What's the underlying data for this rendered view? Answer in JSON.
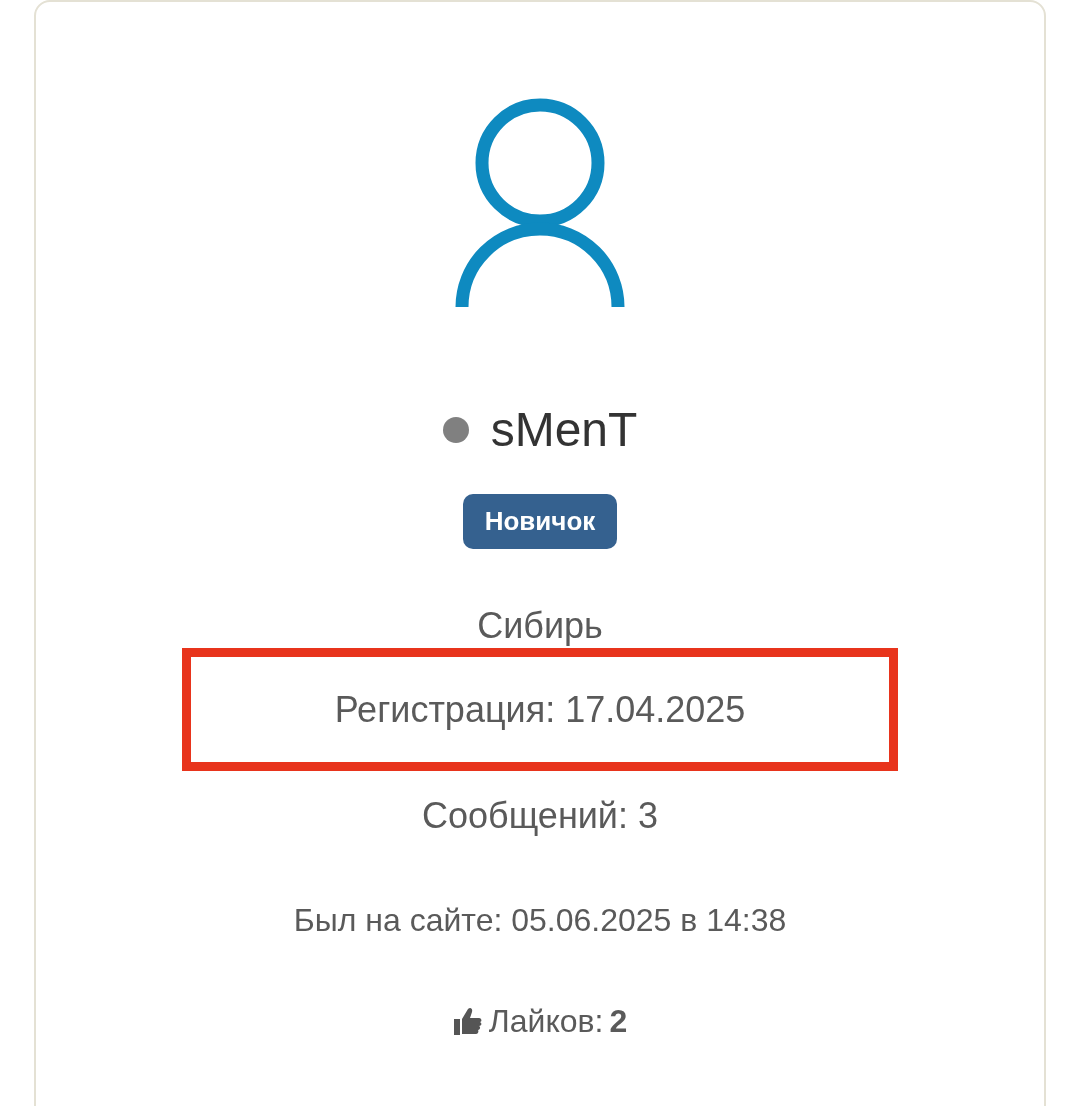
{
  "profile": {
    "online": false,
    "username": "sMenT",
    "rank": "Новичок",
    "location": "Сибирь",
    "stats": [
      {
        "text": "Регистрация: 17.04.2025",
        "highlighted": true
      },
      {
        "text": "Сообщений: 3",
        "highlighted": false
      }
    ],
    "last_seen": "Был на сайте: 05.06.2025 в 14:38",
    "likes": {
      "label": "Лайков:",
      "count": "2"
    }
  }
}
